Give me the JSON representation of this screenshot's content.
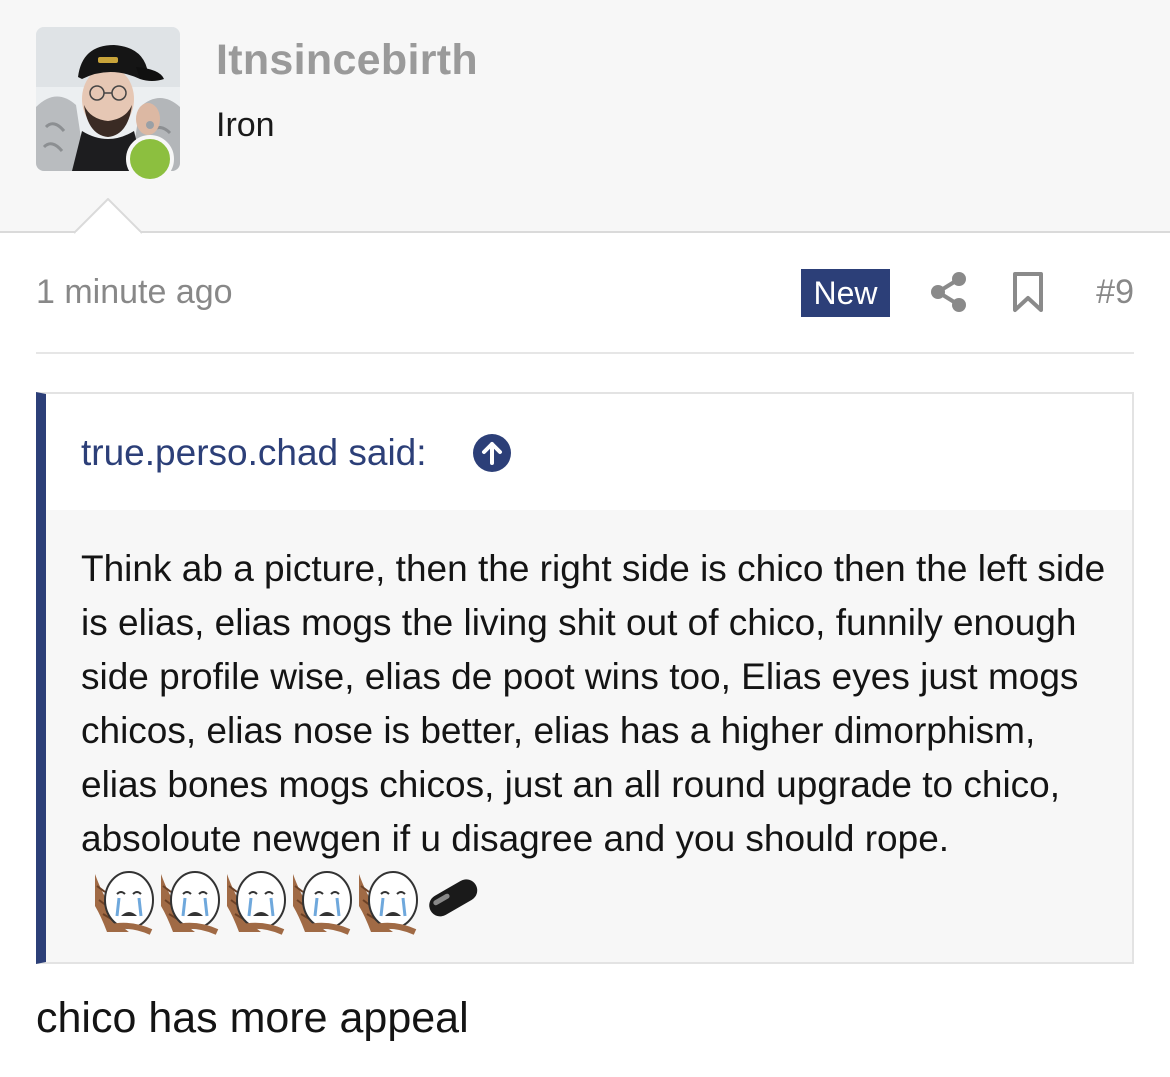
{
  "user": {
    "name": "Itnsincebirth",
    "rank": "Iron",
    "online": true,
    "avatar_icon": "user-avatar-photo"
  },
  "post": {
    "timestamp": "1 minute ago",
    "badge": "New",
    "share_icon": "share-icon",
    "bookmark_icon": "bookmark-icon",
    "number": "#9",
    "reply": "chico has more appeal"
  },
  "quote": {
    "author": "true.perso.chad said:",
    "jump_icon": "arrow-up-circle-icon",
    "text": "Think ab a picture, then the right side is chico then the left side is elias, elias mogs the living shit out of chico, funnily enough side profile wise, elias de poot wins too, Elias eyes just mogs chicos, elias nose is better, elias has a higher dimorphism, elias bones mogs chicos, just an all round upgrade to chico, absoloute newgen if u disagree and you should rope.",
    "emojis": [
      "crying-rope-face",
      "crying-rope-face",
      "crying-rope-face",
      "crying-rope-face",
      "crying-rope-face",
      "black-pill"
    ]
  },
  "colors": {
    "accent": "#2c3f78",
    "online": "#8cbf3f",
    "muted": "#888888"
  }
}
